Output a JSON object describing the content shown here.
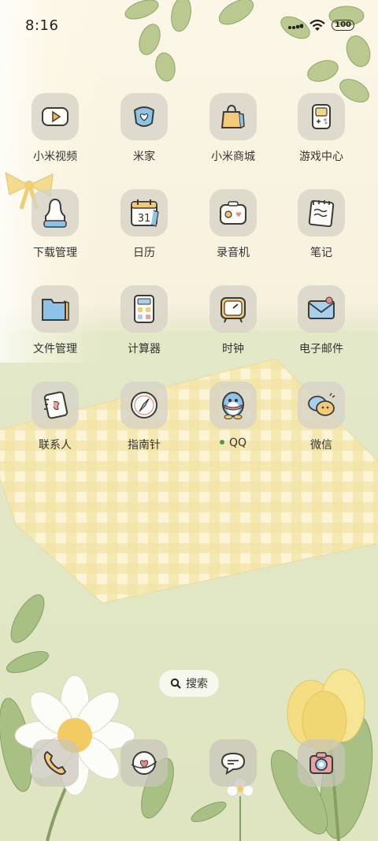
{
  "status_bar": {
    "time": "8:16",
    "battery": "100"
  },
  "apps": [
    {
      "id": "xiaomi-video",
      "label": "小米视频",
      "icon": "play-video-icon"
    },
    {
      "id": "mijia",
      "label": "米家",
      "icon": "home-heart-icon"
    },
    {
      "id": "mi-store",
      "label": "小米商城",
      "icon": "shopping-bag-icon"
    },
    {
      "id": "game-center",
      "label": "游戏中心",
      "icon": "gamepad-icon"
    },
    {
      "id": "downloads",
      "label": "下载管理",
      "icon": "download-icon"
    },
    {
      "id": "calendar",
      "label": "日历",
      "icon": "calendar-icon",
      "day": "31"
    },
    {
      "id": "recorder",
      "label": "录音机",
      "icon": "recorder-icon"
    },
    {
      "id": "notes",
      "label": "笔记",
      "icon": "notes-icon"
    },
    {
      "id": "files",
      "label": "文件管理",
      "icon": "folder-icon"
    },
    {
      "id": "calculator",
      "label": "计算器",
      "icon": "calculator-icon"
    },
    {
      "id": "clock",
      "label": "时钟",
      "icon": "clock-icon"
    },
    {
      "id": "email",
      "label": "电子邮件",
      "icon": "mail-icon"
    },
    {
      "id": "contacts",
      "label": "联系人",
      "icon": "contacts-icon"
    },
    {
      "id": "compass",
      "label": "指南针",
      "icon": "compass-icon"
    },
    {
      "id": "qq",
      "label": "QQ",
      "icon": "qq-penguin-icon",
      "new_dot": true
    },
    {
      "id": "wechat",
      "label": "微信",
      "icon": "wechat-icon"
    }
  ],
  "search": {
    "label": "搜索"
  },
  "dock": [
    {
      "id": "phone",
      "icon": "phone-icon"
    },
    {
      "id": "browser",
      "icon": "browser-heart-icon"
    },
    {
      "id": "messages",
      "icon": "message-icon"
    },
    {
      "id": "camera",
      "icon": "camera-icon"
    }
  ],
  "colors": {
    "accent_green": "#4a9a4a",
    "wall": "#fbf6e6",
    "floor": "#e1e6c5",
    "blanket": "#f5e6a8"
  }
}
